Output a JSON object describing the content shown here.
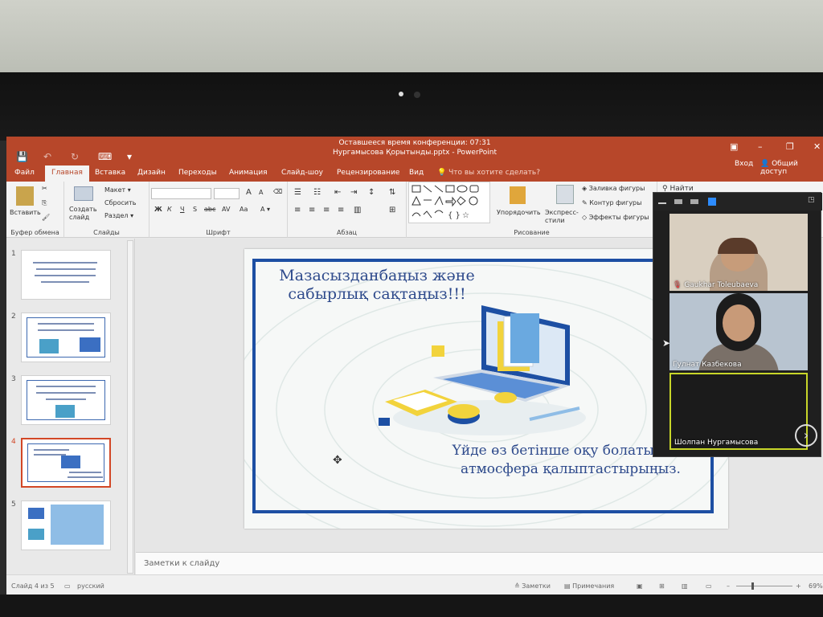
{
  "window": {
    "conference_timer": "Оставшееся время конференции: 07:31",
    "doc_title": "Нургамысова Қорытынды.pptx - PowerPoint",
    "login": "Вход",
    "share": "Общий доступ"
  },
  "menu": {
    "tabs": [
      "Файл",
      "Главная",
      "Вставка",
      "Дизайн",
      "Переходы",
      "Анимация",
      "Слайд-шоу",
      "Рецензирование",
      "Вид"
    ],
    "tell_me": "Что вы хотите сделать?"
  },
  "ribbon": {
    "clipboard": {
      "paste": "Вставить",
      "label": "Буфер обмена"
    },
    "slides": {
      "new_slide": "Создать слайд",
      "layout": "Макет",
      "reset": "Сбросить",
      "section": "Раздел",
      "label": "Слайды"
    },
    "font": {
      "label": "Шрифт",
      "bold": "Ж",
      "italic": "К",
      "underline": "Ч",
      "strike": "S",
      "abc": "abc",
      "spacing": "AV",
      "case": "Aa",
      "grow": "A",
      "shrink": "A"
    },
    "paragraph": {
      "label": "Абзац"
    },
    "drawing": {
      "arrange": "Упорядочить",
      "styles": "Экспресс-стили",
      "fill": "Заливка фигуры",
      "outline": "Контур фигуры",
      "effects": "Эффекты фигуры",
      "label": "Рисование"
    },
    "editing": {
      "find": "Найти"
    }
  },
  "thumbnails": [
    {
      "num": "1"
    },
    {
      "num": "2"
    },
    {
      "num": "3"
    },
    {
      "num": "4",
      "selected": true
    },
    {
      "num": "5"
    }
  ],
  "slide": {
    "heading": "Мазасызданбаңыз және сабырлық сақтаңыз!!!",
    "body": "Үйде өз бетінше оқу болатындай атмосфера қалыптастырыңыз."
  },
  "notes_placeholder": "Заметки к слайду",
  "status": {
    "slide_of": "Слайд 4 из 5",
    "language": "русский",
    "notes": "Заметки",
    "comments": "Примечания",
    "zoom_pct": "69%"
  },
  "zoom": {
    "participants": [
      {
        "name": "Gaukhar Toleubaeva",
        "muted": true
      },
      {
        "name": "Гулнат Казбекова",
        "muted": false
      },
      {
        "name": "Шолпан Нургамысова",
        "muted": false,
        "active": true
      }
    ]
  },
  "colors": {
    "accent": "#b7472a",
    "slide_blue": "#1d4fa3",
    "active_speaker": "#c8d629"
  }
}
